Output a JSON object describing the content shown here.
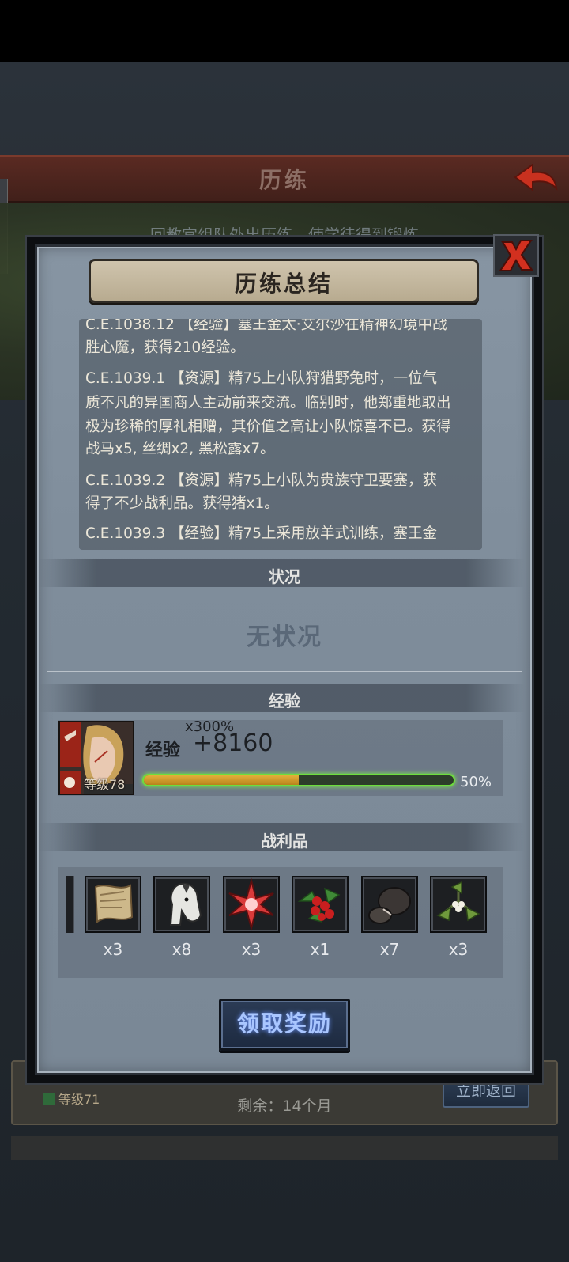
{
  "background": {
    "header_title": "历练",
    "banner_text": "回教宫组队外出历练，使学徒得到锻炼",
    "card_level": "等级71",
    "remaining": "剩余：14个月",
    "return_button": "立即返回"
  },
  "dialog": {
    "title": "历练总结",
    "log": [
      {
        "date": "C.E.1038.12",
        "tag": "【经验】",
        "text": "塞王金太·艾尔沙在精神幻境中战胜心魔，获得210经验。"
      },
      {
        "date": "C.E.1039.1",
        "tag": "【资源】",
        "text": "精75上小队狩猎野兔时，一位气质不凡的异国商人主动前来交流。临别时，他郑重地取出极为珍稀的厚礼相赠，其价值之高让小队惊喜不已。获得战马x5, 丝绸x2, 黑松露x7。"
      },
      {
        "date": "C.E.1039.2",
        "tag": "【资源】",
        "text": "精75上小队为贵族守卫要塞，获得了不少战利品。获得猪x1。"
      },
      {
        "date": "C.E.1039.3",
        "tag": "【经验】",
        "text": "精75上采用放羊式训练，塞王金"
      }
    ],
    "log_lines": [
      "C.E.1038.12 【经验】塞王金太·艾尔沙在精神幻境中战",
      "胜心魔，获得210经验。",
      "C.E.1039.1 【资源】精75上小队狩猎野兔时，一位气",
      "质不凡的异国商人主动前来交流。临别时，他郑重地取出",
      "极为珍稀的厚礼相赠，其价值之高让小队惊喜不已。获得",
      "战马x5, 丝绸x2, 黑松露x7。",
      "C.E.1039.2 【资源】精75上小队为贵族守卫要塞，获",
      "得了不少战利品。获得猪x1。",
      "C.E.1039.3 【经验】精75上采用放羊式训练，塞王金"
    ],
    "status_section": "状况",
    "status_value": "无状况",
    "exp_section": "经验",
    "exp": {
      "multiplier": "x300%",
      "label": "经验",
      "gain": "+8160",
      "progress": 0.5,
      "progress_text": "50%",
      "level": "等级78"
    },
    "loot_section": "战利品",
    "loot": [
      {
        "icon": "scroll-icon",
        "count": "x3"
      },
      {
        "icon": "horse-icon",
        "count": "x8"
      },
      {
        "icon": "red-star-icon",
        "count": "x3"
      },
      {
        "icon": "berries-icon",
        "count": "x1"
      },
      {
        "icon": "truffle-icon",
        "count": "x7"
      },
      {
        "icon": "mistletoe-icon",
        "count": "x3"
      }
    ],
    "claim_button": "领取奖励"
  },
  "colors": {
    "accent_green": "#6dde3c",
    "exp_fill": "#e2b03a",
    "header_red": "#5a2a22"
  }
}
